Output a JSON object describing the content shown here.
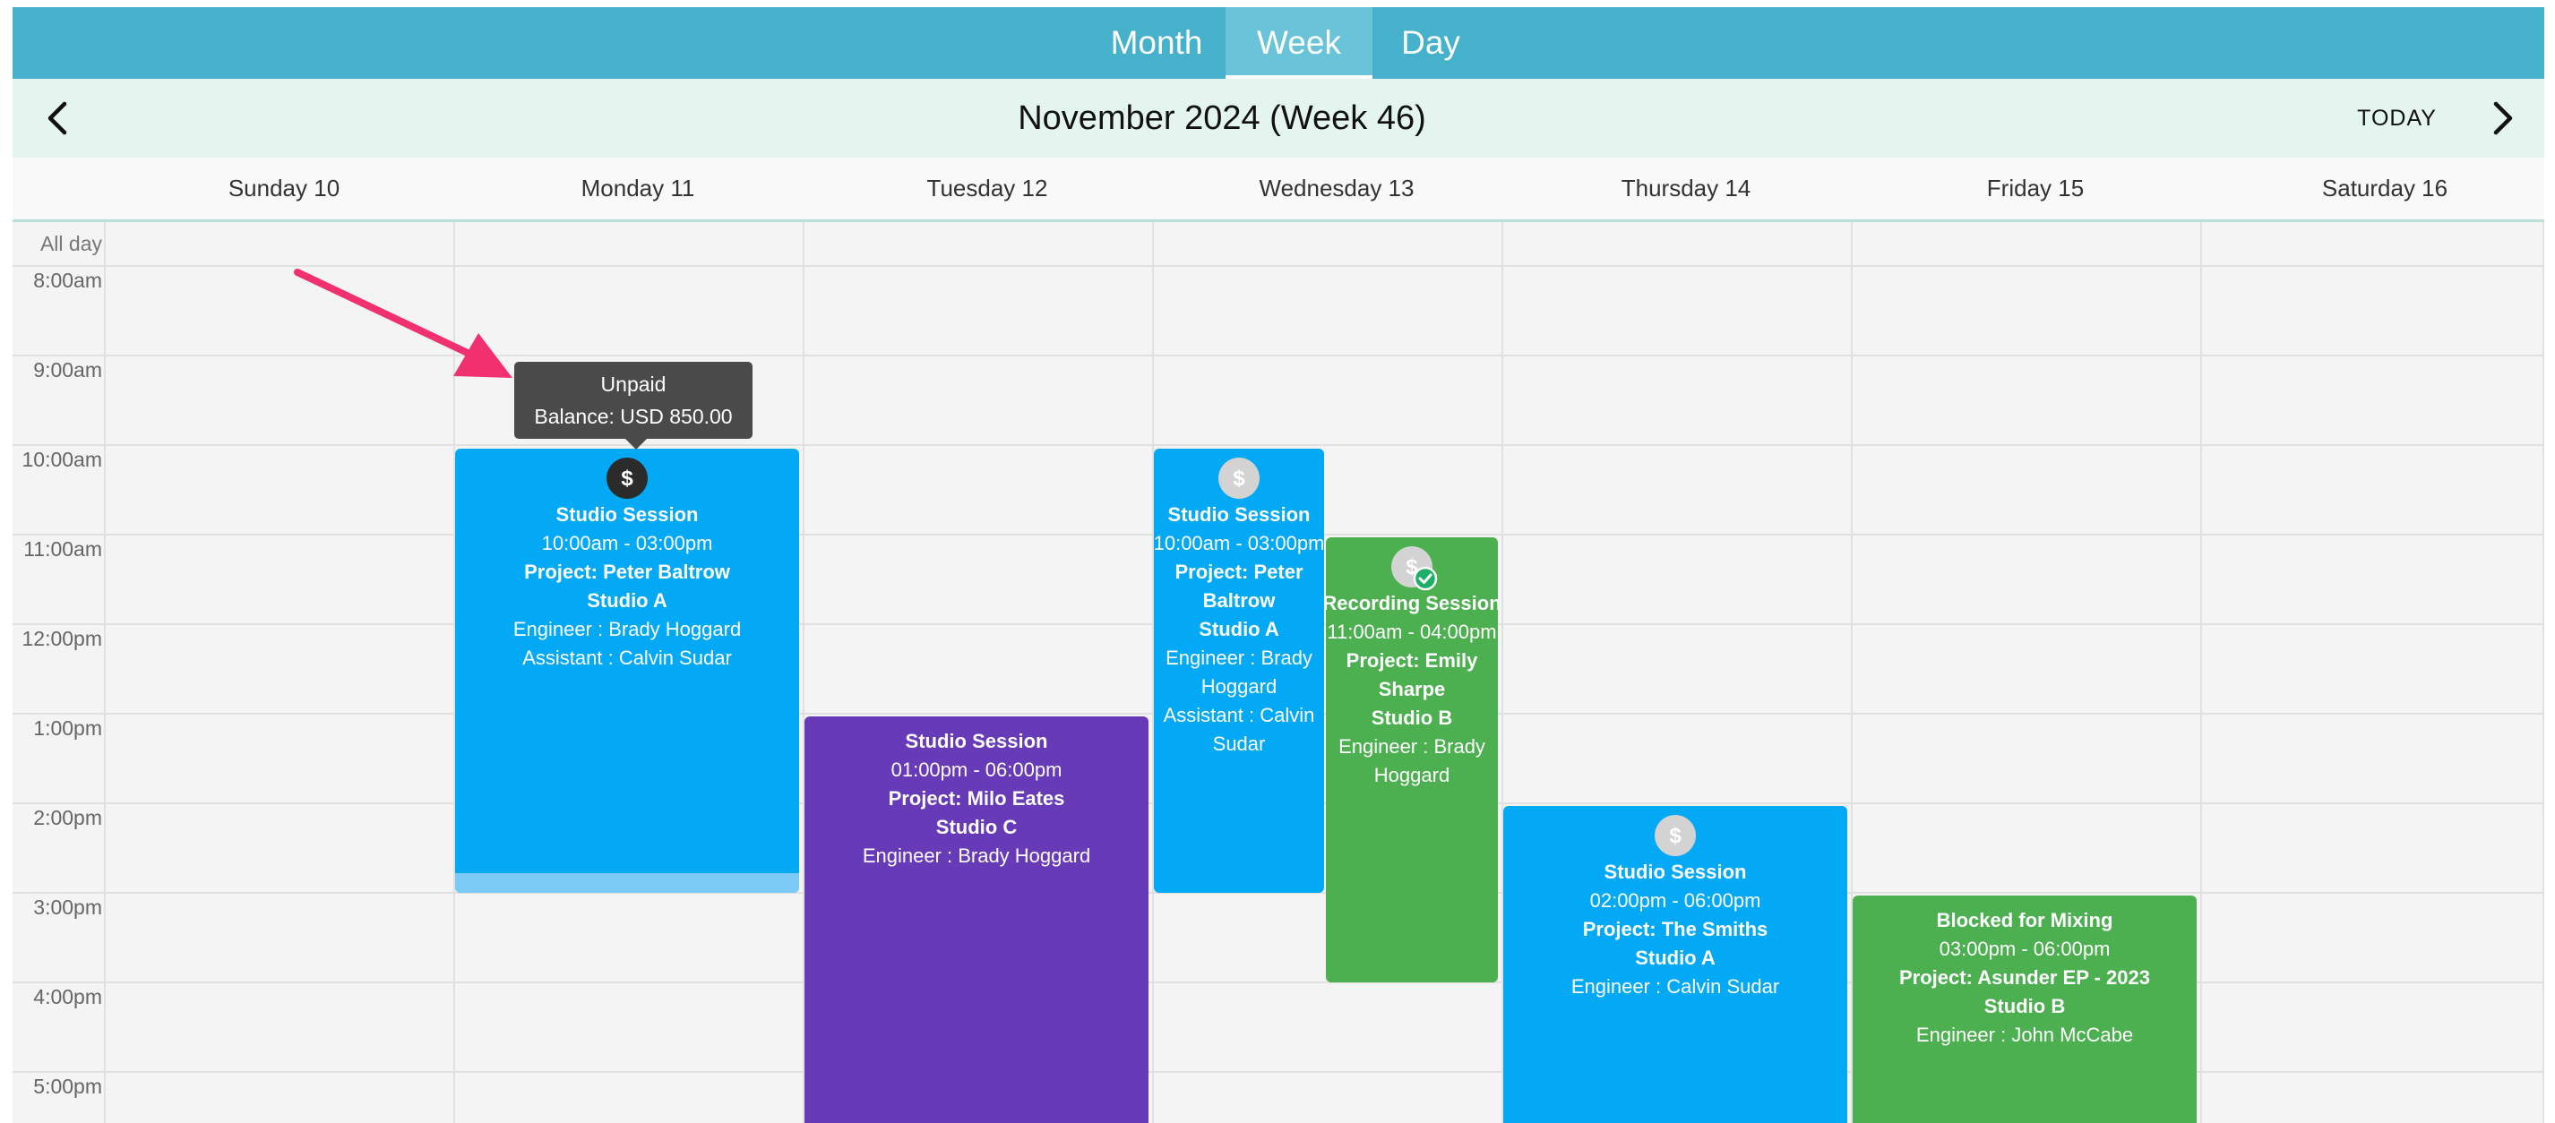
{
  "view_switch": {
    "tabs": [
      "Month",
      "Week",
      "Day"
    ],
    "active": "Week"
  },
  "header": {
    "title": "November 2024 (Week 46)",
    "today_label": "TODAY"
  },
  "days": [
    "Sunday 10",
    "Monday 11",
    "Tuesday 12",
    "Wednesday 13",
    "Thursday 14",
    "Friday 15",
    "Saturday 16"
  ],
  "allday_label": "All day",
  "hours": [
    "8:00am",
    "9:00am",
    "10:00am",
    "11:00am",
    "12:00pm",
    "1:00pm",
    "2:00pm",
    "3:00pm",
    "4:00pm",
    "5:00pm"
  ],
  "tooltip": {
    "line1": "Unpaid",
    "line2": "Balance: USD 850.00"
  },
  "colors": {
    "header": "#46b1cb",
    "session_blue": "#03a9f4",
    "session_purple": "#673ab7",
    "session_green": "#4caf50"
  },
  "events": [
    {
      "title": "Studio Session",
      "time": "10:00am - 03:00pm",
      "project": "Project: Peter Baltrow",
      "room": "Studio A",
      "engineer": "Engineer : Brady Hoggard",
      "assistant": "Assistant : Calvin Sudar",
      "payment_icon": "dollar-dark-icon"
    },
    {
      "title": "Studio Session",
      "time": "01:00pm - 06:00pm",
      "project": "Project: Milo Eates",
      "room": "Studio C",
      "engineer": "Engineer : Brady Hoggard"
    },
    {
      "title": "Studio Session",
      "time": "10:00am - 03:00pm",
      "project_a": "Project: Peter",
      "project_b": "Baltrow",
      "room": "Studio A",
      "engineer_a": "Engineer : Brady",
      "engineer_b": "Hoggard",
      "assistant_a": "Assistant : Calvin",
      "assistant_b": "Sudar",
      "payment_icon": "dollar-grey-icon"
    },
    {
      "title": "Recording Session",
      "time": "11:00am - 04:00pm",
      "project_a": "Project: Emily",
      "project_b": "Sharpe",
      "room": "Studio B",
      "engineer_a": "Engineer : Brady",
      "engineer_b": "Hoggard",
      "payment_icon": "dollar-paid-icon"
    },
    {
      "title": "Studio Session",
      "time": "02:00pm - 06:00pm",
      "project": "Project: The Smiths",
      "room": "Studio A",
      "engineer": "Engineer : Calvin Sudar",
      "payment_icon": "dollar-grey-icon"
    },
    {
      "title": "Blocked for Mixing",
      "time": "03:00pm - 06:00pm",
      "project": "Project: Asunder EP - 2023",
      "room": "Studio B",
      "engineer": "Engineer : John McCabe"
    }
  ]
}
